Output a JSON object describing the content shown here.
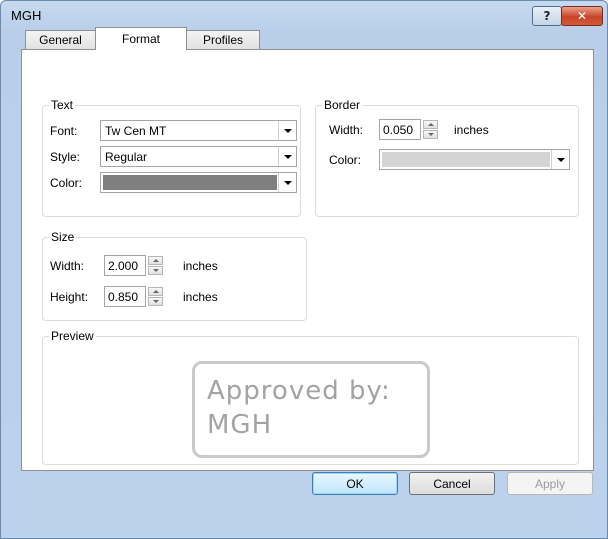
{
  "window": {
    "title": "MGH",
    "help_glyph": "?",
    "close_glyph": "✕"
  },
  "tabs": [
    {
      "label": "General"
    },
    {
      "label": "Format"
    },
    {
      "label": "Profiles"
    }
  ],
  "text_group": {
    "title": "Text",
    "font_label": "Font:",
    "font_value": "Tw Cen MT",
    "style_label": "Style:",
    "style_value": "Regular",
    "color_label": "Color:",
    "color_value": "#7f7f7f"
  },
  "border_group": {
    "title": "Border",
    "width_label": "Width:",
    "width_value": "0.050",
    "width_unit": "inches",
    "color_label": "Color:",
    "color_value": "#d4d4d4"
  },
  "size_group": {
    "title": "Size",
    "width_label": "Width:",
    "width_value": "2.000",
    "width_unit": "inches",
    "height_label": "Height:",
    "height_value": "0.850",
    "height_unit": "inches"
  },
  "preview_group": {
    "title": "Preview",
    "stamp_line1": "Approved by:",
    "stamp_line2": "MGH"
  },
  "buttons": {
    "ok": "OK",
    "cancel": "Cancel",
    "apply": "Apply"
  }
}
